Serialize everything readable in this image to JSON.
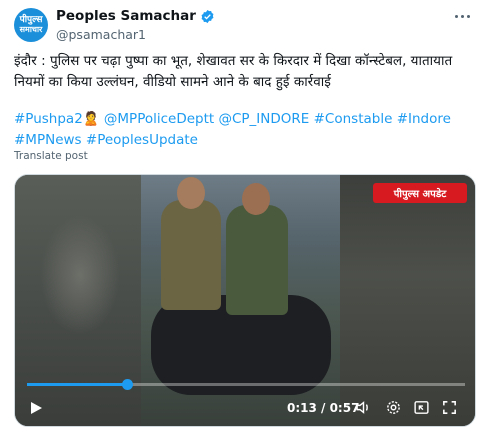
{
  "account": {
    "avatar_line1": "पीपुल्स",
    "avatar_line2": "समाचार",
    "display_name": "Peoples Samachar",
    "handle": "@psamachar1"
  },
  "tweet": {
    "text": "इंदौर : पुलिस पर चढ़ा पुष्पा का भूत, शेखावत सर के किरदार में दिखा कॉन्स्टेबल, यातायात नियमों का किया उल्लंघन, वीडियो सामने आने के बाद हुई कार्रवाई",
    "hashtags": [
      "#Pushpa2",
      "🙎",
      " @MPPoliceDeptt",
      " @CP_INDORE",
      " #Constable",
      " #Indore",
      " #MPNews",
      " #PeoplesUpdate"
    ],
    "translate_label": "Translate post"
  },
  "video": {
    "brand_badge": "पीपुल्स अपडेट",
    "progress_fraction": 0.228,
    "time": "0:13 / 0:57"
  },
  "icons": {
    "verified": "verified-badge-icon",
    "more": "more-icon",
    "play": "play-icon",
    "volume": "volume-icon",
    "settings": "gear-icon",
    "pip": "picture-in-picture-icon",
    "fullscreen": "fullscreen-icon"
  },
  "colors": {
    "accent": "#1d9bf0",
    "brand_red": "#d71920",
    "avatar_blue": "#1b8fd9"
  }
}
